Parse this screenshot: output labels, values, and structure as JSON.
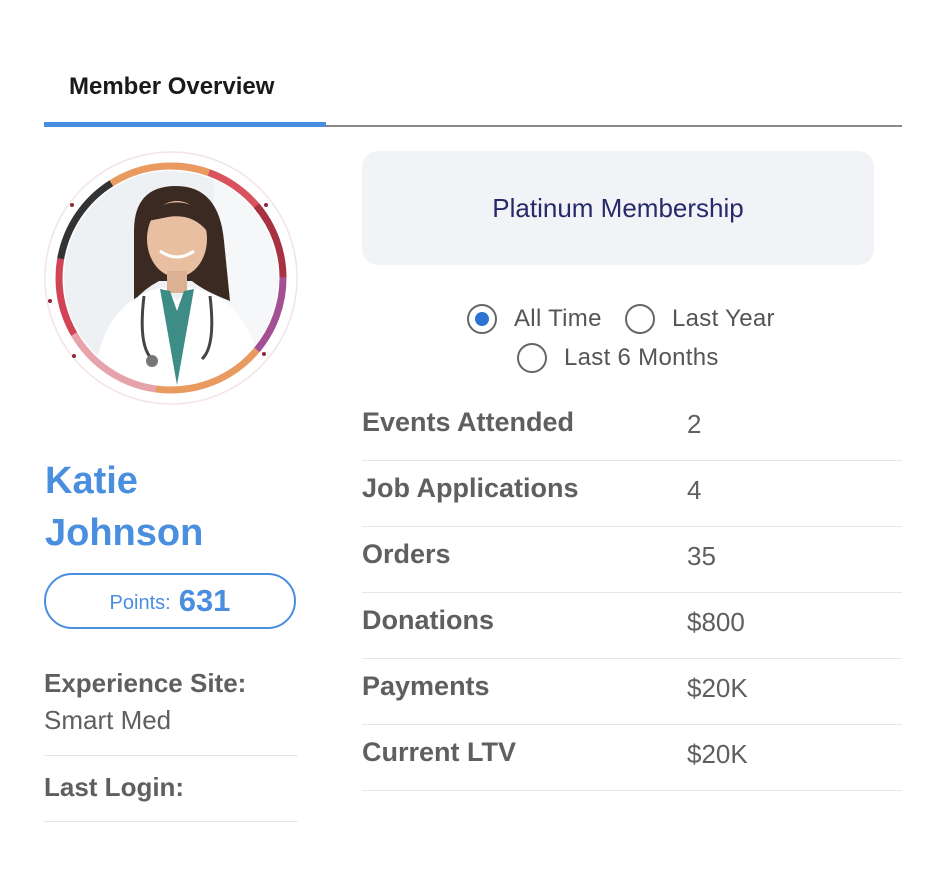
{
  "tabs": [
    {
      "label": "Member Overview",
      "active": true
    }
  ],
  "member": {
    "first_name": "Katie",
    "last_name": "Johnson",
    "points_label": "Points:",
    "points_value": "631",
    "avatar": "doctor-portrait-photo"
  },
  "info": {
    "experience_site_label": "Experience Site:",
    "experience_site_value": "Smart Med",
    "last_login_label": "Last Login:",
    "last_login_value": ""
  },
  "membership": {
    "label": "Platinum Membership"
  },
  "time_filter": {
    "options": [
      "All Time",
      "Last Year",
      "Last 6 Months"
    ],
    "selected": "All Time"
  },
  "stats": [
    {
      "label": "Events Attended",
      "value": "2"
    },
    {
      "label": "Job Applications",
      "value": "4"
    },
    {
      "label": "Orders",
      "value": "35"
    },
    {
      "label": "Donations",
      "value": "$800"
    },
    {
      "label": "Payments",
      "value": "$20K"
    },
    {
      "label": "Current LTV",
      "value": "$20K"
    }
  ],
  "colors": {
    "accent": "#4a8ee0",
    "radio_checked": "#2e72d2",
    "membership_text": "#262a6b",
    "membership_bg": "#f2f3f6",
    "label_gray": "#5f5f5f"
  }
}
